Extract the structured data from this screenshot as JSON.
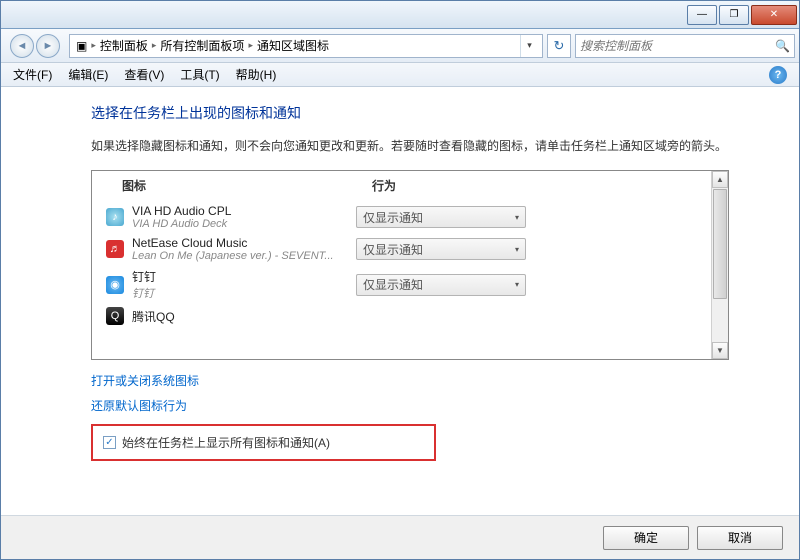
{
  "titlebar": {
    "min": "—",
    "max": "❐",
    "close": "✕"
  },
  "nav": {
    "back": "◄",
    "fwd": "►",
    "crumb_icon": "▣",
    "crumbs": [
      "控制面板",
      "所有控制面板项",
      "通知区域图标"
    ],
    "arrow": "▸",
    "dropdown": "▾",
    "refresh": "↻"
  },
  "search": {
    "placeholder": "搜索控制面板",
    "icon": "🔍"
  },
  "menu": {
    "file": "文件(F)",
    "edit": "编辑(E)",
    "view": "查看(V)",
    "tools": "工具(T)",
    "help": "帮助(H)",
    "q": "?"
  },
  "page": {
    "title": "选择在任务栏上出现的图标和通知",
    "desc": "如果选择隐藏图标和通知，则不会向您通知更改和更新。若要随时查看隐藏的图标，请单击任务栏上通知区域旁的箭头。",
    "col_icon": "图标",
    "col_action": "行为",
    "link1": "打开或关闭系统图标",
    "link2": "还原默认图标行为",
    "checkbox_label": "始终在任务栏上显示所有图标和通知(A)",
    "checked": "✓",
    "scroll_up": "▲",
    "scroll_dn": "▼"
  },
  "items": [
    {
      "name": "VIA HD Audio CPL",
      "sub": "VIA HD Audio Deck",
      "action": "仅显示通知",
      "ic": "ic-via",
      "glyph": "♪"
    },
    {
      "name": "NetEase Cloud Music",
      "sub": "Lean On Me (Japanese ver.) - SEVENT...",
      "action": "仅显示通知",
      "ic": "ic-ne",
      "glyph": "♬"
    },
    {
      "name": "钉钉",
      "sub": "钉钉",
      "action": "仅显示通知",
      "ic": "ic-dd",
      "glyph": "◉"
    },
    {
      "name": "腾讯QQ",
      "sub": "",
      "action": "",
      "ic": "ic-qq",
      "glyph": "Q"
    }
  ],
  "combo_arrow": "▾",
  "footer": {
    "ok": "确定",
    "cancel": "取消"
  }
}
